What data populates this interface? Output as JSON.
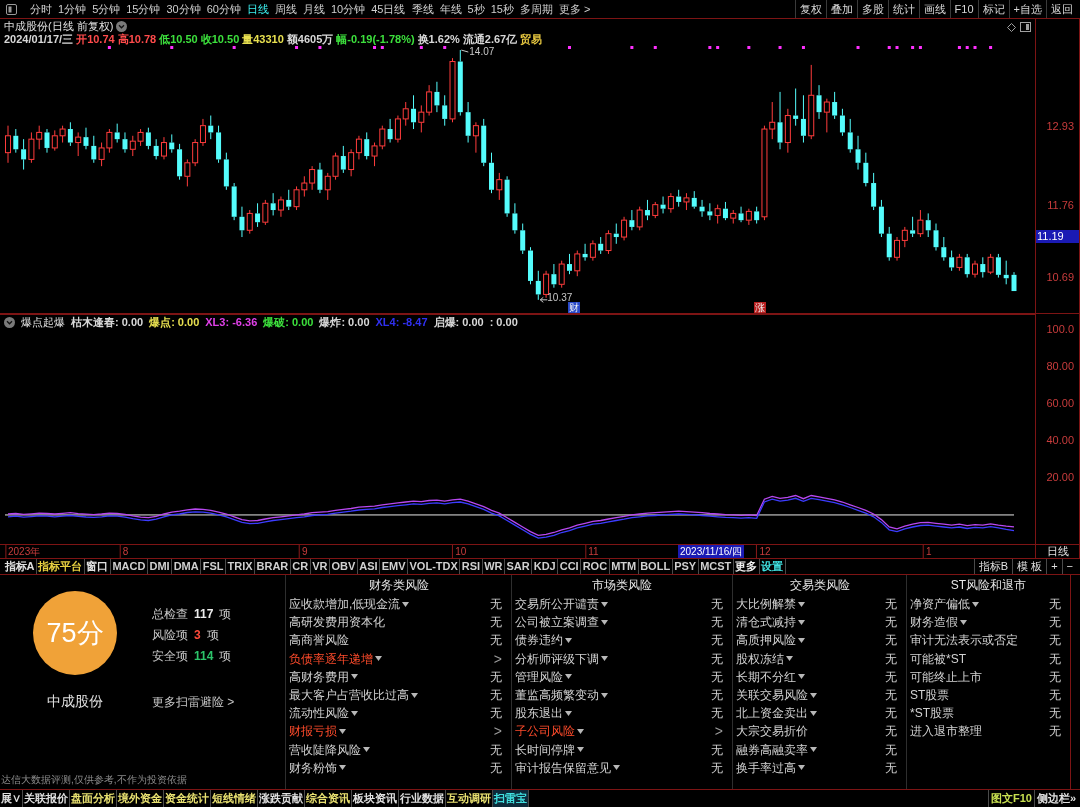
{
  "toolbar": {
    "periods": [
      {
        "label": "分时",
        "selected": false
      },
      {
        "label": "1分钟",
        "selected": false
      },
      {
        "label": "5分钟",
        "selected": false
      },
      {
        "label": "15分钟",
        "selected": false
      },
      {
        "label": "30分钟",
        "selected": false
      },
      {
        "label": "60分钟",
        "selected": false
      },
      {
        "label": "日线",
        "selected": true
      },
      {
        "label": "周线",
        "selected": false
      },
      {
        "label": "月线",
        "selected": false
      },
      {
        "label": "10分钟",
        "selected": false
      },
      {
        "label": "45日线",
        "selected": false
      },
      {
        "label": "季线",
        "selected": false
      },
      {
        "label": "年线",
        "selected": false
      },
      {
        "label": "5秒",
        "selected": false
      },
      {
        "label": "15秒",
        "selected": false
      },
      {
        "label": "多周期",
        "selected": false
      }
    ],
    "more": "更多 >",
    "tools": [
      "复权",
      "叠加",
      "多股",
      "统计",
      "画线",
      "F10",
      "标记",
      "+自选",
      "返回"
    ]
  },
  "quote": {
    "title": "中成股份(日线 前复权)",
    "fields": [
      {
        "text": "2024/01/17/三",
        "color": "#d8d8d8"
      },
      {
        "text": "开10.74",
        "color": "#ff4b4b"
      },
      {
        "text": "高10.78",
        "color": "#ff4b4b"
      },
      {
        "text": "低10.50",
        "color": "#3ce03c"
      },
      {
        "text": "收10.50",
        "color": "#3ce03c"
      },
      {
        "text": "量43310",
        "color": "#e8e050"
      },
      {
        "text": "额4605万",
        "color": "#d8d8d8"
      },
      {
        "text": "幅-0.19(-1.78%)",
        "color": "#3ce03c"
      },
      {
        "text": "换1.62%",
        "color": "#d8d8d8"
      },
      {
        "text": "流通2.67亿",
        "color": "#d8d8d8"
      },
      {
        "text": "贸易",
        "color": "#e8c840"
      }
    ]
  },
  "price_chart": {
    "cursor_label": "11.19",
    "event_tags": [
      {
        "text": "财",
        "color": "#2848c8"
      },
      {
        "text": "涨",
        "color": "#b82020"
      }
    ],
    "chart_data": [
      {
        "type": "candlestick",
        "ohlc": [
          [
            12.55,
            12.95,
            12.4,
            12.8
          ],
          [
            12.8,
            12.9,
            12.55,
            12.6
          ],
          [
            12.6,
            12.75,
            12.3,
            12.45
          ],
          [
            12.45,
            12.85,
            12.4,
            12.75
          ],
          [
            12.75,
            12.95,
            12.6,
            12.85
          ],
          [
            12.85,
            12.9,
            12.55,
            12.62
          ],
          [
            12.62,
            12.88,
            12.58,
            12.8
          ],
          [
            12.8,
            12.95,
            12.7,
            12.9
          ],
          [
            12.9,
            13.0,
            12.65,
            12.7
          ],
          [
            12.7,
            12.85,
            12.5,
            12.78
          ],
          [
            12.78,
            12.92,
            12.6,
            12.65
          ],
          [
            12.65,
            12.8,
            12.4,
            12.45
          ],
          [
            12.45,
            12.7,
            12.35,
            12.62
          ],
          [
            12.62,
            12.9,
            12.55,
            12.85
          ],
          [
            12.85,
            12.98,
            12.7,
            12.75
          ],
          [
            12.75,
            12.85,
            12.55,
            12.6
          ],
          [
            12.6,
            12.8,
            12.5,
            12.72
          ],
          [
            12.72,
            12.9,
            12.65,
            12.85
          ],
          [
            12.85,
            12.92,
            12.6,
            12.65
          ],
          [
            12.65,
            12.75,
            12.45,
            12.5
          ],
          [
            12.5,
            12.78,
            12.45,
            12.7
          ],
          [
            12.7,
            12.82,
            12.55,
            12.6
          ],
          [
            12.6,
            12.68,
            12.15,
            12.2
          ],
          [
            12.2,
            12.45,
            12.05,
            12.4
          ],
          [
            12.4,
            12.75,
            12.35,
            12.7
          ],
          [
            12.7,
            13.05,
            12.65,
            12.95
          ],
          [
            12.95,
            13.1,
            12.75,
            12.85
          ],
          [
            12.85,
            12.95,
            12.4,
            12.45
          ],
          [
            12.45,
            12.55,
            12.0,
            12.05
          ],
          [
            12.05,
            12.1,
            11.55,
            11.6
          ],
          [
            11.6,
            11.75,
            11.3,
            11.4
          ],
          [
            11.4,
            11.7,
            11.35,
            11.65
          ],
          [
            11.65,
            11.8,
            11.45,
            11.52
          ],
          [
            11.52,
            11.85,
            11.48,
            11.8
          ],
          [
            11.8,
            11.95,
            11.62,
            11.7
          ],
          [
            11.7,
            11.9,
            11.6,
            11.85
          ],
          [
            11.85,
            12.0,
            11.7,
            11.75
          ],
          [
            11.75,
            12.05,
            11.7,
            12.0
          ],
          [
            12.0,
            12.2,
            11.9,
            12.1
          ],
          [
            12.1,
            12.35,
            12.0,
            12.3
          ],
          [
            12.3,
            12.4,
            11.95,
            12.0
          ],
          [
            12.0,
            12.25,
            11.85,
            12.2
          ],
          [
            12.2,
            12.55,
            12.15,
            12.5
          ],
          [
            12.5,
            12.65,
            12.25,
            12.3
          ],
          [
            12.3,
            12.6,
            12.2,
            12.55
          ],
          [
            12.55,
            12.8,
            12.45,
            12.75
          ],
          [
            12.75,
            12.85,
            12.45,
            12.5
          ],
          [
            12.5,
            12.7,
            12.35,
            12.65
          ],
          [
            12.65,
            12.95,
            12.6,
            12.9
          ],
          [
            12.9,
            13.05,
            12.7,
            12.75
          ],
          [
            12.75,
            13.1,
            12.7,
            13.05
          ],
          [
            13.05,
            13.3,
            12.95,
            13.2
          ],
          [
            13.2,
            13.4,
            12.9,
            13.0
          ],
          [
            13.0,
            13.25,
            12.85,
            13.15
          ],
          [
            13.15,
            13.55,
            13.1,
            13.45
          ],
          [
            13.45,
            13.6,
            13.15,
            13.25
          ],
          [
            13.25,
            13.4,
            12.95,
            13.05
          ],
          [
            13.05,
            13.95,
            13.0,
            13.9
          ],
          [
            13.9,
            14.07,
            13.1,
            13.15
          ],
          [
            13.15,
            13.3,
            12.7,
            12.8
          ],
          [
            12.8,
            13.0,
            12.55,
            12.95
          ],
          [
            12.95,
            13.05,
            12.35,
            12.4
          ],
          [
            12.4,
            12.55,
            11.95,
            12.0
          ],
          [
            12.0,
            12.25,
            11.85,
            12.15
          ],
          [
            12.15,
            12.2,
            11.6,
            11.65
          ],
          [
            11.65,
            11.8,
            11.35,
            11.4
          ],
          [
            11.4,
            11.5,
            11.05,
            11.1
          ],
          [
            11.1,
            11.15,
            10.6,
            10.65
          ],
          [
            10.65,
            10.8,
            10.37,
            10.45
          ],
          [
            10.45,
            10.8,
            10.4,
            10.75
          ],
          [
            10.75,
            10.9,
            10.55,
            10.6
          ],
          [
            10.6,
            10.95,
            10.55,
            10.9
          ],
          [
            10.9,
            11.05,
            10.75,
            10.8
          ],
          [
            10.8,
            11.1,
            10.72,
            11.05
          ],
          [
            11.05,
            11.2,
            10.95,
            11.0
          ],
          [
            11.0,
            11.25,
            10.95,
            11.2
          ],
          [
            11.2,
            11.3,
            11.05,
            11.1
          ],
          [
            11.1,
            11.4,
            11.05,
            11.35
          ],
          [
            11.35,
            11.5,
            11.2,
            11.3
          ],
          [
            11.3,
            11.6,
            11.25,
            11.55
          ],
          [
            11.55,
            11.7,
            11.4,
            11.45
          ],
          [
            11.45,
            11.75,
            11.4,
            11.7
          ],
          [
            11.7,
            11.85,
            11.55,
            11.62
          ],
          [
            11.62,
            11.82,
            11.58,
            11.78
          ],
          [
            11.78,
            11.9,
            11.65,
            11.72
          ],
          [
            11.72,
            11.95,
            11.66,
            11.9
          ],
          [
            11.9,
            12.0,
            11.75,
            11.82
          ],
          [
            11.82,
            11.95,
            11.7,
            11.88
          ],
          [
            11.88,
            11.98,
            11.72,
            11.75
          ],
          [
            11.75,
            11.85,
            11.6,
            11.68
          ],
          [
            11.68,
            11.8,
            11.55,
            11.62
          ],
          [
            11.62,
            11.78,
            11.5,
            11.72
          ],
          [
            11.72,
            11.82,
            11.55,
            11.58
          ],
          [
            11.58,
            11.7,
            11.5,
            11.65
          ],
          [
            11.65,
            11.75,
            11.52,
            11.55
          ],
          [
            11.55,
            11.72,
            11.48,
            11.68
          ],
          [
            11.68,
            11.75,
            11.5,
            11.55
          ],
          [
            11.6,
            12.95,
            11.55,
            12.9
          ],
          [
            12.9,
            13.3,
            12.75,
            13.0
          ],
          [
            13.0,
            13.45,
            12.6,
            12.7
          ],
          [
            12.7,
            13.2,
            12.55,
            13.1
          ],
          [
            13.1,
            13.5,
            12.95,
            13.05
          ],
          [
            13.05,
            13.4,
            12.7,
            12.8
          ],
          [
            12.8,
            13.85,
            12.75,
            13.4
          ],
          [
            13.4,
            13.55,
            13.05,
            13.15
          ],
          [
            13.15,
            13.35,
            12.85,
            13.3
          ],
          [
            13.3,
            13.45,
            13.05,
            13.1
          ],
          [
            13.1,
            13.2,
            12.8,
            12.85
          ],
          [
            12.85,
            13.05,
            12.55,
            12.6
          ],
          [
            12.6,
            12.8,
            12.3,
            12.4
          ],
          [
            12.4,
            12.55,
            12.05,
            12.1
          ],
          [
            12.1,
            12.25,
            11.7,
            11.75
          ],
          [
            11.75,
            11.85,
            11.3,
            11.35
          ],
          [
            11.35,
            11.45,
            10.95,
            11.0
          ],
          [
            11.0,
            11.3,
            10.95,
            11.25
          ],
          [
            11.25,
            11.45,
            11.15,
            11.4
          ],
          [
            11.4,
            11.6,
            11.3,
            11.35
          ],
          [
            11.35,
            11.7,
            11.3,
            11.55
          ],
          [
            11.55,
            11.65,
            11.3,
            11.4
          ],
          [
            11.4,
            11.5,
            11.1,
            11.15
          ],
          [
            11.15,
            11.3,
            10.95,
            11.0
          ],
          [
            11.0,
            11.1,
            10.8,
            10.85
          ],
          [
            10.85,
            11.05,
            10.8,
            11.0
          ],
          [
            11.0,
            11.05,
            10.7,
            10.75
          ],
          [
            10.75,
            10.95,
            10.7,
            10.9
          ],
          [
            10.9,
            11.0,
            10.7,
            10.78
          ],
          [
            10.78,
            11.05,
            10.75,
            11.0
          ],
          [
            11.0,
            11.05,
            10.7,
            10.74
          ],
          [
            10.74,
            10.95,
            10.6,
            10.69
          ],
          [
            10.74,
            10.78,
            10.5,
            10.5
          ]
        ],
        "ylim": [
          10.16,
          14.53
        ],
        "yticks": [
          {
            "value": 12.93,
            "label": "12.93"
          },
          {
            "value": 11.76,
            "label": "11.76"
          },
          {
            "value": 10.69,
            "label": "10.69"
          }
        ],
        "annotations": [
          "14.07",
          "10.37"
        ]
      }
    ]
  },
  "indicator": {
    "title": "爆点起爆",
    "legend": [
      {
        "text": "枯木逢春: 0.00",
        "color": "#d8d8d8"
      },
      {
        "text": "爆点: 0.00",
        "color": "#e8e050"
      },
      {
        "text": "XL3: -6.36",
        "color": "#e040e8"
      },
      {
        "text": "爆破: 0.00",
        "color": "#3ce03c"
      },
      {
        "text": "爆炸: 0.00",
        "color": "#d8d8d8"
      },
      {
        "text": "XL4: -8.47",
        "color": "#3030f0"
      },
      {
        "text": "启爆: 0.00",
        "color": "#d8d8d8"
      },
      {
        "text": ": 0.00",
        "color": "#d8d8d8"
      }
    ],
    "cursor_label": "2023/11/16/四",
    "period_label": "日线",
    "chart_data": [
      {
        "type": "line",
        "categories": [
          null,
          null,
          "2023年",
          null,
          null,
          null,
          null,
          null,
          null,
          null,
          null,
          null,
          null,
          null,
          null,
          "8",
          null,
          null,
          null,
          null,
          null,
          null,
          null,
          null,
          null,
          null,
          null,
          null,
          null,
          null,
          null,
          null,
          null,
          null,
          null,
          null,
          null,
          null,
          "9",
          null,
          null,
          null,
          null,
          null,
          null,
          null,
          null,
          null,
          null,
          null,
          null,
          null,
          null,
          null,
          null,
          null,
          null,
          null,
          "10",
          null,
          null,
          null,
          null,
          null,
          null,
          null,
          null,
          null,
          null,
          null,
          null,
          null,
          null,
          null,
          null,
          "11",
          null,
          null,
          null,
          null,
          null,
          null,
          null,
          null,
          null,
          null,
          null,
          null,
          null,
          null,
          null,
          null,
          null,
          null,
          null,
          null,
          null,
          "12",
          null,
          null,
          null,
          null,
          null,
          null,
          null,
          null,
          null,
          null,
          null,
          null,
          null,
          null,
          null,
          null,
          null,
          null,
          null,
          null,
          "1",
          null,
          null,
          null,
          null,
          null,
          null,
          null,
          null,
          null,
          null,
          null
        ],
        "series": [
          {
            "color": "#b848f0",
            "values": [
              0.5,
              0.8,
              0.3,
              0.6,
              1.0,
              0.8,
              0.5,
              0.9,
              1.2,
              0.7,
              0.4,
              0.2,
              0.5,
              1.0,
              0.8,
              0.3,
              -0.5,
              -1.2,
              -1.5,
              -0.8,
              0.5,
              1.5,
              2.0,
              2.8,
              3.2,
              3.0,
              2.5,
              1.5,
              0.5,
              -1.0,
              -2.5,
              -3.2,
              -3.0,
              -2.2,
              -1.5,
              -1.0,
              -0.5,
              0.0,
              0.5,
              1.2,
              1.5,
              1.8,
              2.5,
              3.0,
              3.5,
              4.2,
              4.5,
              4.8,
              5.5,
              6.0,
              6.5,
              7.0,
              7.5,
              7.2,
              7.8,
              8.0,
              7.5,
              8.2,
              8.5,
              7.5,
              6.0,
              4.5,
              2.5,
              1.0,
              -1.5,
              -4.0,
              -6.5,
              -9.0,
              -11.0,
              -10.5,
              -9.5,
              -8.0,
              -7.0,
              -5.5,
              -4.5,
              -3.5,
              -3.0,
              -2.2,
              -1.5,
              -0.8,
              0.0,
              0.5,
              1.0,
              1.2,
              1.5,
              1.8,
              2.0,
              1.8,
              1.5,
              1.2,
              0.8,
              0.5,
              0.2,
              0.0,
              -0.2,
              0.0,
              -0.3,
              8.5,
              10.0,
              9.0,
              9.5,
              10.5,
              8.8,
              10.5,
              9.8,
              9.0,
              8.2,
              7.0,
              5.5,
              4.0,
              2.5,
              0.5,
              -2.5,
              -6.5,
              -7.5,
              -6.0,
              -5.0,
              -4.2,
              -4.0,
              -4.5,
              -5.0,
              -5.5,
              -5.0,
              -5.8,
              -5.2,
              -5.5,
              -4.8,
              -5.5,
              -6.0,
              -6.4
            ]
          },
          {
            "color": "#3c3cff",
            "values": [
              -1.0,
              -0.7,
              -1.2,
              -0.9,
              -0.5,
              -0.7,
              -1.0,
              -0.6,
              -0.3,
              -0.8,
              -1.1,
              -1.3,
              -1.0,
              -0.5,
              -0.7,
              -1.2,
              -2.0,
              -2.7,
              -3.0,
              -2.3,
              -1.0,
              0.0,
              0.5,
              1.3,
              1.7,
              1.5,
              1.0,
              0.0,
              -1.0,
              -2.5,
              -4.0,
              -4.7,
              -4.5,
              -3.7,
              -3.0,
              -2.5,
              -2.0,
              -1.5,
              -1.0,
              -0.3,
              0.0,
              0.3,
              1.0,
              1.5,
              2.0,
              2.7,
              3.0,
              3.3,
              4.0,
              4.5,
              5.0,
              5.5,
              6.0,
              5.7,
              6.3,
              6.5,
              6.0,
              6.7,
              7.0,
              6.0,
              4.5,
              3.0,
              1.0,
              -0.5,
              -3.0,
              -5.5,
              -8.0,
              -10.5,
              -12.5,
              -12.0,
              -11.0,
              -9.5,
              -8.5,
              -7.0,
              -6.0,
              -5.0,
              -4.5,
              -3.7,
              -3.0,
              -2.3,
              -1.5,
              -1.0,
              -0.5,
              -0.3,
              0.0,
              0.3,
              0.5,
              0.3,
              0.0,
              -0.3,
              -0.7,
              -1.0,
              -1.3,
              -1.5,
              -1.7,
              -1.5,
              -1.8,
              7.0,
              8.5,
              7.5,
              8.0,
              9.0,
              7.3,
              9.0,
              8.3,
              7.5,
              6.7,
              5.5,
              4.0,
              2.5,
              1.0,
              -1.0,
              -4.0,
              -8.0,
              -9.0,
              -7.5,
              -6.5,
              -5.7,
              -5.5,
              -6.0,
              -6.5,
              -7.0,
              -6.5,
              -7.3,
              -6.7,
              -7.0,
              -6.3,
              -7.0,
              -7.8,
              -8.5
            ]
          }
        ],
        "ylim": [
          -15.7,
          108.6
        ],
        "yticks": [
          {
            "value": 100,
            "label": "100.0"
          },
          {
            "value": 80,
            "label": "80.00"
          },
          {
            "value": 60,
            "label": "60.00"
          },
          {
            "value": 40,
            "label": "40.00"
          },
          {
            "value": 20,
            "label": "20.00"
          }
        ],
        "ref_lines": [
          {
            "axis": "y",
            "value": 0,
            "color": "#e8e8e8"
          }
        ]
      }
    ]
  },
  "indicator_tabs": {
    "items": [
      {
        "label": "指标A",
        "color": "#e0e0e0"
      },
      {
        "label": "指标平台",
        "color": "#e8d040"
      },
      {
        "label": "窗口",
        "color": "#e0e0e0"
      },
      {
        "label": "MACD",
        "color": "#d0d0d0"
      },
      {
        "label": "DMI",
        "color": "#d0d0d0"
      },
      {
        "label": "DMA",
        "color": "#d0d0d0"
      },
      {
        "label": "FSL",
        "color": "#d0d0d0"
      },
      {
        "label": "TRIX",
        "color": "#d0d0d0"
      },
      {
        "label": "BRAR",
        "color": "#d0d0d0"
      },
      {
        "label": "CR",
        "color": "#d0d0d0"
      },
      {
        "label": "VR",
        "color": "#d0d0d0"
      },
      {
        "label": "OBV",
        "color": "#d0d0d0"
      },
      {
        "label": "ASI",
        "color": "#d0d0d0"
      },
      {
        "label": "EMV",
        "color": "#d0d0d0"
      },
      {
        "label": "VOL-TDX",
        "color": "#d0d0d0"
      },
      {
        "label": "RSI",
        "color": "#d0d0d0"
      },
      {
        "label": "WR",
        "color": "#d0d0d0"
      },
      {
        "label": "SAR",
        "color": "#d0d0d0"
      },
      {
        "label": "KDJ",
        "color": "#d0d0d0"
      },
      {
        "label": "CCI",
        "color": "#d0d0d0"
      },
      {
        "label": "ROC",
        "color": "#d0d0d0"
      },
      {
        "label": "MTM",
        "color": "#d0d0d0"
      },
      {
        "label": "BOLL",
        "color": "#d0d0d0"
      },
      {
        "label": "PSY",
        "color": "#d0d0d0"
      },
      {
        "label": "MCST",
        "color": "#d0d0d0"
      },
      {
        "label": "更多",
        "color": "#f0f0f0"
      },
      {
        "label": "设置",
        "color": "#40e0e0"
      }
    ],
    "right": [
      "指标B",
      "模 板",
      "+",
      "−"
    ]
  },
  "scan": {
    "score": "75分",
    "stock": "中成股份",
    "stats": [
      {
        "label": "总检查",
        "count": "117",
        "unit": "项",
        "color": "#ececec"
      },
      {
        "label": "风险项",
        "count": "3",
        "unit": "项",
        "color": "#ff4a3a"
      },
      {
        "label": "安全项",
        "count": "114",
        "unit": "项",
        "color": "#2cc46a"
      }
    ],
    "more_link": "更多扫雷避险 >",
    "disclaimer": "达信大数据评测,仅供参考,不作为投资依据",
    "columns": [
      {
        "title": "财务类风险",
        "rows": [
          {
            "label": "应收款增加,低现金流",
            "dropdown": true,
            "risk": false,
            "value": "无"
          },
          {
            "label": "高研发费用资本化",
            "dropdown": false,
            "risk": false,
            "value": "无"
          },
          {
            "label": "高商誉风险",
            "dropdown": false,
            "risk": false,
            "value": "无"
          },
          {
            "label": "负债率逐年递增",
            "dropdown": true,
            "risk": true,
            "value": ">"
          },
          {
            "label": "高财务费用",
            "dropdown": true,
            "risk": false,
            "value": "无"
          },
          {
            "label": "最大客户占营收比过高",
            "dropdown": true,
            "risk": false,
            "value": "无"
          },
          {
            "label": "流动性风险",
            "dropdown": true,
            "risk": false,
            "value": "无"
          },
          {
            "label": "财报亏损",
            "dropdown": true,
            "risk": true,
            "value": ">"
          },
          {
            "label": "营收陡降风险",
            "dropdown": true,
            "risk": false,
            "value": "无"
          },
          {
            "label": "财务粉饰",
            "dropdown": true,
            "risk": false,
            "value": "无"
          }
        ]
      },
      {
        "title": "市场类风险",
        "rows": [
          {
            "label": "交易所公开谴责",
            "dropdown": true,
            "risk": false,
            "value": "无"
          },
          {
            "label": "公司被立案调查",
            "dropdown": true,
            "risk": false,
            "value": "无"
          },
          {
            "label": "债券违约",
            "dropdown": true,
            "risk": false,
            "value": "无"
          },
          {
            "label": "分析师评级下调",
            "dropdown": true,
            "risk": false,
            "value": "无"
          },
          {
            "label": "管理风险",
            "dropdown": true,
            "risk": false,
            "value": "无"
          },
          {
            "label": "董监高频繁变动",
            "dropdown": true,
            "risk": false,
            "value": "无"
          },
          {
            "label": "股东退出",
            "dropdown": true,
            "risk": false,
            "value": "无"
          },
          {
            "label": "子公司风险",
            "dropdown": true,
            "risk": true,
            "value": ">"
          },
          {
            "label": "长时间停牌",
            "dropdown": true,
            "risk": false,
            "value": "无"
          },
          {
            "label": "审计报告保留意见",
            "dropdown": true,
            "risk": false,
            "value": "无"
          }
        ]
      },
      {
        "title": "交易类风险",
        "rows": [
          {
            "label": "大比例解禁",
            "dropdown": true,
            "risk": false,
            "value": "无"
          },
          {
            "label": "清仓式减持",
            "dropdown": true,
            "risk": false,
            "value": "无"
          },
          {
            "label": "高质押风险",
            "dropdown": true,
            "risk": false,
            "value": "无"
          },
          {
            "label": "股权冻结",
            "dropdown": true,
            "risk": false,
            "value": "无"
          },
          {
            "label": "长期不分红",
            "dropdown": true,
            "risk": false,
            "value": "无"
          },
          {
            "label": "关联交易风险",
            "dropdown": true,
            "risk": false,
            "value": "无"
          },
          {
            "label": "北上资金卖出",
            "dropdown": true,
            "risk": false,
            "value": "无"
          },
          {
            "label": "大宗交易折价",
            "dropdown": false,
            "risk": false,
            "value": "无"
          },
          {
            "label": "融券高融卖率",
            "dropdown": true,
            "risk": false,
            "value": "无"
          },
          {
            "label": "换手率过高",
            "dropdown": true,
            "risk": false,
            "value": "无"
          }
        ]
      },
      {
        "title": "ST风险和退市",
        "rows": [
          {
            "label": "净资产偏低",
            "dropdown": true,
            "risk": false,
            "value": "无"
          },
          {
            "label": "财务造假",
            "dropdown": true,
            "risk": false,
            "value": "无"
          },
          {
            "label": "审计无法表示或否定",
            "dropdown": false,
            "risk": false,
            "value": "无"
          },
          {
            "label": "可能被*ST",
            "dropdown": false,
            "risk": false,
            "value": "无"
          },
          {
            "label": "可能终止上市",
            "dropdown": false,
            "risk": false,
            "value": "无"
          },
          {
            "label": "ST股票",
            "dropdown": false,
            "risk": false,
            "value": "无"
          },
          {
            "label": "*ST股票",
            "dropdown": false,
            "risk": false,
            "value": "无"
          },
          {
            "label": "进入退市整理",
            "dropdown": false,
            "risk": false,
            "value": "无"
          }
        ]
      }
    ]
  },
  "bottom_tabs": {
    "items": [
      {
        "label": "展∨",
        "selected": false,
        "color": "#e0e0e0"
      },
      {
        "label": "关联报价",
        "selected": false,
        "color": "#e0e0e0"
      },
      {
        "label": "盘面分析",
        "selected": false,
        "color": "#e8e070"
      },
      {
        "label": "境外资金",
        "selected": false,
        "color": "#e8e070"
      },
      {
        "label": "资金统计",
        "selected": false,
        "color": "#e8e070"
      },
      {
        "label": "短线情绪",
        "selected": false,
        "color": "#e8e070"
      },
      {
        "label": "涨跌贡献",
        "selected": false,
        "color": "#e0e0e0"
      },
      {
        "label": "综合资讯",
        "selected": false,
        "color": "#e8e070"
      },
      {
        "label": "板块资讯",
        "selected": false,
        "color": "#e0e0e0"
      },
      {
        "label": "行业数据",
        "selected": false,
        "color": "#e0e0e0"
      },
      {
        "label": "互动调研",
        "selected": false,
        "color": "#e8e070"
      },
      {
        "label": "扫雷宝",
        "selected": true
      }
    ],
    "right": [
      {
        "label": "图文F10",
        "color": "#c8e050"
      },
      {
        "label": "侧边栏»",
        "color": "#e0e0e0"
      }
    ]
  }
}
